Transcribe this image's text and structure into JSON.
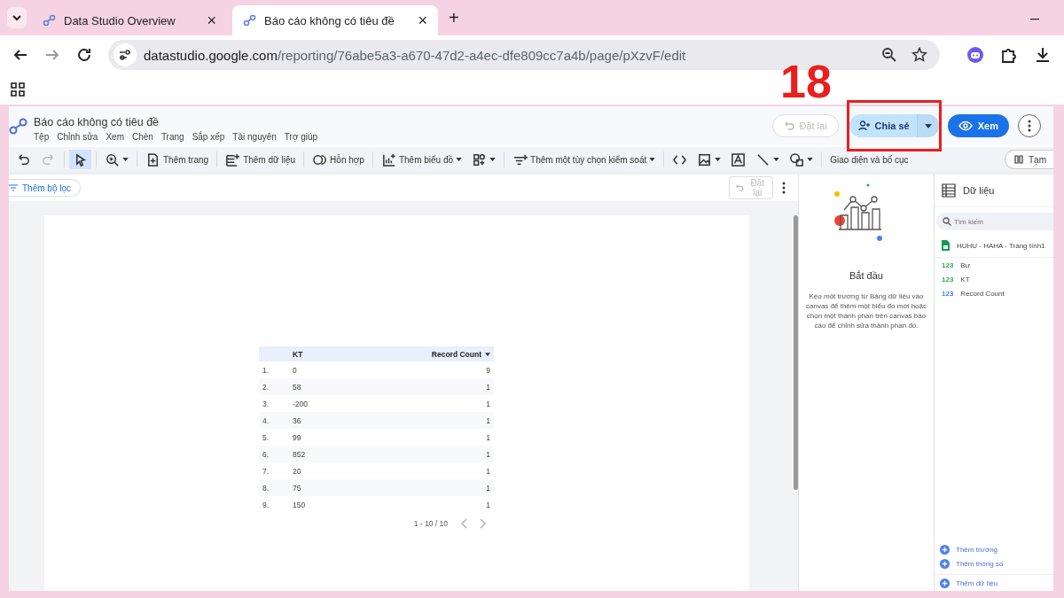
{
  "browser": {
    "tabs": [
      {
        "title": "Data Studio Overview",
        "selected": false,
        "close": "×"
      },
      {
        "title": "Báo cáo không có tiêu đề",
        "selected": true,
        "close": "×"
      }
    ],
    "new_tab": "+",
    "minimize": "–",
    "url_host": "datastudio.google.com",
    "url_path": "/reporting/76abe5a3-a670-47d2-a4ec-dfe809cc7a4b/page/pXzvF/edit"
  },
  "annotation": {
    "number": "18"
  },
  "report": {
    "title": "Báo cáo không có tiêu đề",
    "menu": [
      "Tệp",
      "Chỉnh sửa",
      "Xem",
      "Chèn",
      "Trang",
      "Sắp xếp",
      "Tài nguyên",
      "Trợ giúp"
    ],
    "reset": {
      "label": "Đặt lại",
      "disabled": true
    },
    "share": "Chia sẻ",
    "view": "Xem"
  },
  "toolbar": {
    "groups": [
      [
        {
          "dropdown": false,
          "disabled": false,
          "selected": false
        },
        {
          "dropdown": false,
          "disabled": true,
          "selected": false
        }
      ],
      [
        {
          "dropdown": false,
          "disabled": false,
          "selected": true
        }
      ],
      [
        {
          "dropdown": true,
          "disabled": false,
          "selected": false
        }
      ],
      [
        {
          "label": "Thêm trang",
          "dropdown": false,
          "disabled": false,
          "selected": false
        }
      ],
      [
        {
          "label": "Thêm dữ liệu",
          "dropdown": false,
          "disabled": false,
          "selected": false
        }
      ],
      [
        {
          "label": "Hỗn hợp",
          "dropdown": false,
          "disabled": false,
          "selected": false
        }
      ],
      [
        {
          "label": "Thêm biểu đồ",
          "dropdown": true,
          "disabled": false,
          "selected": false
        },
        {
          "dropdown": true,
          "disabled": false,
          "selected": false
        }
      ],
      [
        {
          "label": "Thêm một tùy chọn kiểm soát",
          "dropdown": true,
          "disabled": false,
          "selected": false
        }
      ],
      [
        {
          "dropdown": false,
          "disabled": false,
          "selected": false
        },
        {
          "dropdown": true,
          "disabled": false,
          "selected": false
        },
        {
          "dropdown": false,
          "disabled": false,
          "selected": false
        },
        {
          "dropdown": true,
          "disabled": false,
          "selected": false
        },
        {
          "dropdown": true,
          "disabled": false,
          "selected": false
        }
      ],
      [
        {
          "label": "Giao diện và bố cục",
          "dropdown": false,
          "disabled": false,
          "selected": false
        }
      ]
    ],
    "right_button": "Tạm"
  },
  "canvas": {
    "add_filter": "Thêm bộ lọc",
    "reset": {
      "label": "Đặt lại",
      "disabled": true
    },
    "table": {
      "columns": [
        {
          "label": "KT",
          "sorted": false
        },
        {
          "label": "Record Count",
          "sorted": true
        }
      ],
      "rows": [
        {
          "index": "1.",
          "cells": [
            "0",
            "9"
          ]
        },
        {
          "index": "2.",
          "cells": [
            "58",
            "1"
          ]
        },
        {
          "index": "3.",
          "cells": [
            "-200",
            "1"
          ]
        },
        {
          "index": "4.",
          "cells": [
            "36",
            "1"
          ]
        },
        {
          "index": "5.",
          "cells": [
            "99",
            "1"
          ]
        },
        {
          "index": "6.",
          "cells": [
            "852",
            "1"
          ]
        },
        {
          "index": "7.",
          "cells": [
            "20",
            "1"
          ]
        },
        {
          "index": "8.",
          "cells": [
            "75",
            "1"
          ]
        },
        {
          "index": "9.",
          "cells": [
            "150",
            "1"
          ]
        }
      ],
      "pagination": "1 - 10 / 10"
    }
  },
  "start_panel": {
    "title": "Bắt đầu",
    "text": "Kéo một trường từ Bảng dữ liệu vào canvas để thêm một biểu đồ mới hoặc chọn một thành phần trên canvas báo cáo để chỉnh sửa thành phần đó."
  },
  "data_panel": {
    "title": "Dữ liệu",
    "search": {
      "placeholder": "Tìm kiếm"
    },
    "source": "HUHU - HAHA - Trang tính1",
    "fields": [
      {
        "type": "123",
        "name": "Bự",
        "color": "#34a853"
      },
      {
        "type": "123",
        "name": "KT",
        "color": "#34a853"
      },
      {
        "type": "123",
        "name": "Record Count",
        "color": "#4285f4"
      }
    ],
    "actions": [
      "Thêm trường",
      "Thêm thông số"
    ],
    "add_data": "Thêm dữ liệu"
  }
}
